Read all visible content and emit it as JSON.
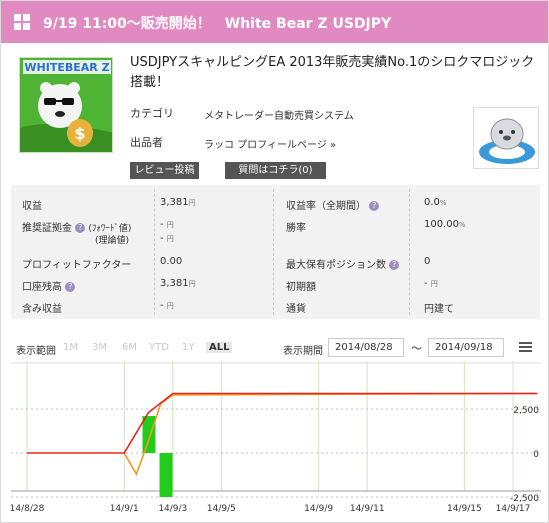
{
  "header": {
    "title": "9/19 11:00～販売開始！　White Bear Z USDJPY"
  },
  "product": {
    "logo_text": "WHITEBEAR Z",
    "title": "USDJPYスキャルピングEA 2013年販売実績No.1のシロクマロジック搭載！",
    "category_label": "カテゴリ",
    "category_value": "メタトレーダー自動売買システム",
    "seller_label": "出品者",
    "seller_value": "ラッコ プロフィールページ »",
    "review_button": "レビュー投稿",
    "question_button": "質問はコチラ(0)"
  },
  "stats": {
    "profit_label": "収益",
    "profit_value": "3,381",
    "profit_unit": "円",
    "profit_rate_label": "収益率（全期間）",
    "profit_rate_value": "0.0",
    "profit_rate_unit": "%",
    "margin_label": "推奨証拠金",
    "margin_sub1": "(ﾌｫﾜｰﾄﾞ値)",
    "margin_sub2": "(理論値)",
    "margin_val1": "-",
    "margin_val2": "-",
    "margin_unit": "円",
    "winrate_label": "勝率",
    "winrate_value": "100.00",
    "winrate_unit": "%",
    "pf_label": "プロフィットファクター",
    "pf_value": "0.00",
    "max_pos_label": "最大保有ポジション数",
    "max_pos_value": "0",
    "balance_label": "口座残高",
    "balance_value": "3,381",
    "balance_unit": "円",
    "initial_label": "初期額",
    "initial_value": "-",
    "initial_unit": "円",
    "unrealized_label": "含み収益",
    "unrealized_value": "-",
    "unrealized_unit": "円",
    "currency_label": "通貨",
    "currency_value": "円建て"
  },
  "range": {
    "label": "表示範囲",
    "buttons": [
      "1M",
      "3M",
      "6M",
      "YTD",
      "1Y",
      "ALL"
    ],
    "active": "ALL",
    "period_label": "表示期間",
    "from": "2014/08/28",
    "to": "2014/09/18",
    "tilde": "～"
  },
  "chart_data": {
    "type": "line",
    "x_ticks": [
      "14/8/28",
      "14/9/1",
      "14/9/3",
      "14/9/5",
      "14/9/9",
      "14/9/11",
      "14/9/15",
      "14/9/17"
    ],
    "y_ticks": [
      "2,500",
      "0",
      "-2,500"
    ],
    "ylim": [
      -2700,
      3600
    ],
    "series": [
      {
        "color": "#e8241c",
        "points": [
          [
            0,
            0
          ],
          [
            4,
            0
          ],
          [
            5,
            2300
          ],
          [
            6,
            3381
          ],
          [
            21,
            3381
          ]
        ]
      },
      {
        "color": "#f39a1e",
        "points": [
          [
            4,
            0
          ],
          [
            4.5,
            -1200
          ],
          [
            5,
            700
          ],
          [
            5.5,
            2800
          ],
          [
            6,
            3300
          ],
          [
            21,
            3381
          ]
        ]
      }
    ],
    "bars": [
      {
        "x": 5,
        "value": 2100
      },
      {
        "x": 5.7,
        "value": -2500
      }
    ],
    "bar_color": "#22cc1a",
    "grid_color": "#cfe8b8"
  }
}
